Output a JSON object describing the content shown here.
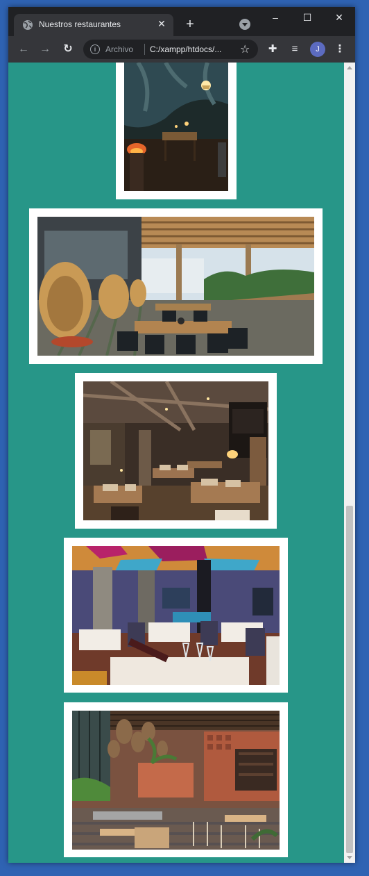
{
  "browser": {
    "tab_title": "Nuestros restaurantes",
    "tab_close": "✕",
    "new_tab": "+",
    "window_controls": {
      "minimize": "–",
      "maximize": "☐",
      "close": "✕"
    },
    "nav": {
      "back": "←",
      "forward": "→",
      "reload": "↻"
    },
    "address_label": "Archivo",
    "address_url": "C:/xampp/htdocs/...",
    "avatar_initial": "J",
    "icons": [
      "globe-icon",
      "tab-search-icon",
      "info-icon",
      "star-icon",
      "extensions-icon",
      "media-icon",
      "menu-icon"
    ]
  },
  "page": {
    "background": "#279688",
    "frame_color": "#ffffff",
    "images": [
      {
        "name": "restaurant-terrace-night",
        "alt": "Terraza nocturna"
      },
      {
        "name": "restaurant-rooftop-pergola",
        "alt": "Azotea con pérgola"
      },
      {
        "name": "restaurant-industrial-dining",
        "alt": "Comedor industrial"
      },
      {
        "name": "restaurant-colorful-interior",
        "alt": "Interior colorido"
      },
      {
        "name": "restaurant-garden-lamps",
        "alt": "Restaurante con lámparas"
      }
    ]
  }
}
